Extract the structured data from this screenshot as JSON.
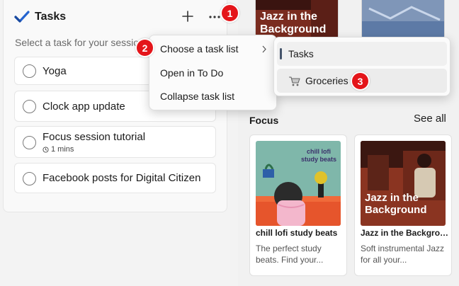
{
  "colors": {
    "accent_badge": "#e4151a",
    "tasks_check_blue": "#2564cf",
    "panel_bg": "#f9f9f9",
    "menu_bg": "#fbfbfb"
  },
  "tasks": {
    "title": "Tasks",
    "prompt": "Select a task for your session",
    "items": [
      {
        "label": "Yoga"
      },
      {
        "label": "Clock app update"
      },
      {
        "label": "Focus session tutorial",
        "sub": "1 mins"
      },
      {
        "label": "Facebook posts for Digital Citizen"
      }
    ],
    "icons": {
      "logo": "todo-check-icon",
      "add": "plus-icon",
      "more": "more-horizontal-icon",
      "clock": "clock-icon"
    }
  },
  "context_menu": {
    "items": [
      {
        "label": "Choose a task list",
        "has_submenu": true
      },
      {
        "label": "Open in To Do"
      },
      {
        "label": "Collapse task list"
      }
    ]
  },
  "submenu": {
    "items": [
      {
        "label": "Tasks",
        "active": true
      },
      {
        "label": "Groceries",
        "icon": "shopping-cart-icon"
      }
    ]
  },
  "badges": [
    "1",
    "2",
    "3"
  ],
  "spotify": {
    "top_card_text": "Jazz in the Background",
    "focus": {
      "title": "Focus",
      "see_all": "See all",
      "cards": [
        {
          "art_text": "chill lofi study beats",
          "title": "chill lofi study beats",
          "desc": "The perfect study beats. Find your..."
        },
        {
          "art_text": "Jazz in the Background",
          "title": "Jazz in the Background",
          "desc": "Soft instrumental Jazz for all your..."
        }
      ]
    }
  }
}
